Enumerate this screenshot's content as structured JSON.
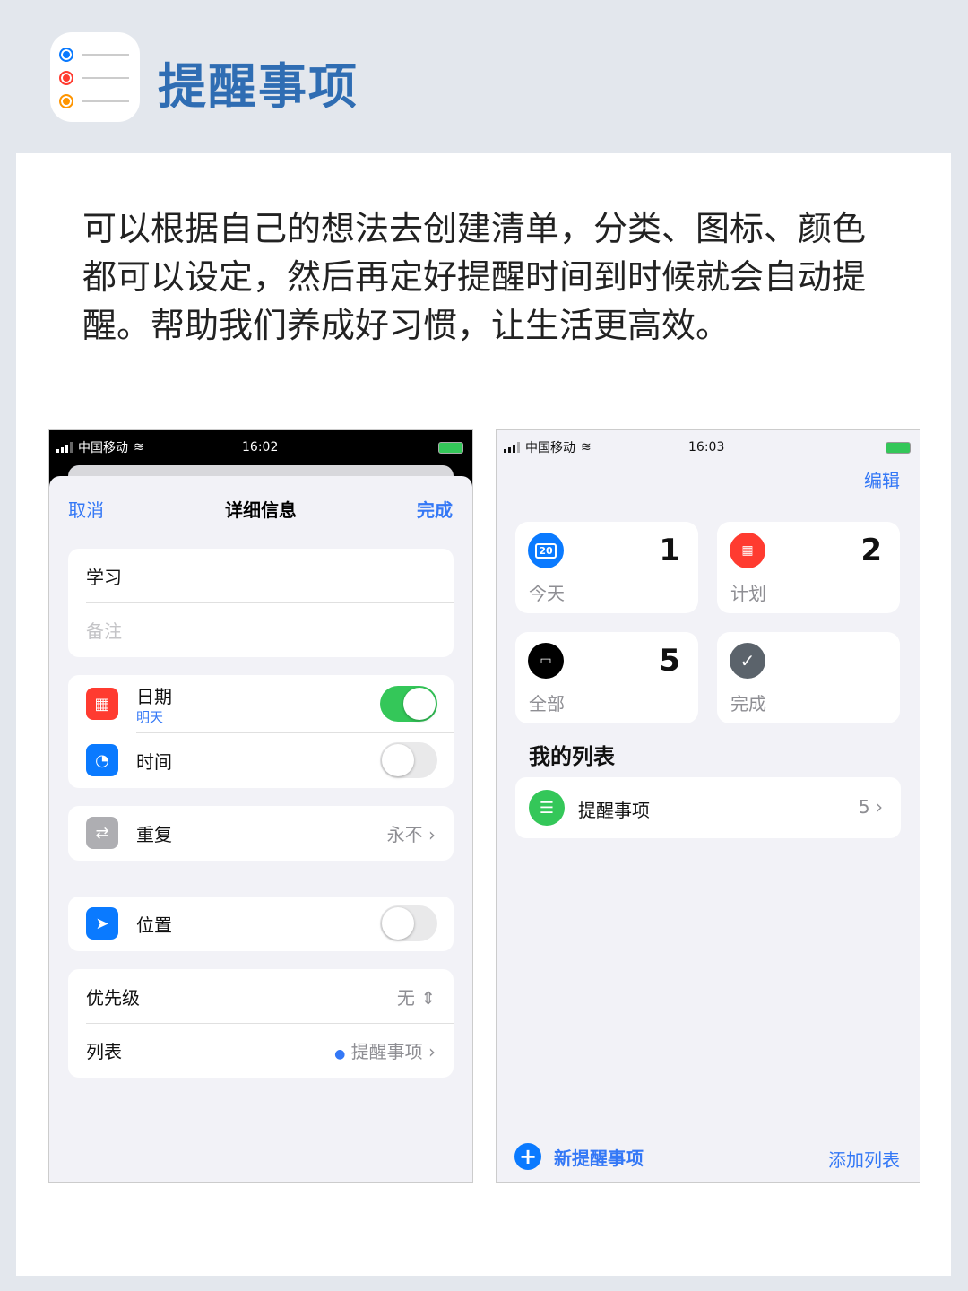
{
  "header": {
    "title": "提醒事项",
    "icon": "reminders-app-icon"
  },
  "description": "可以根据自己的想法去创建清单，分类、图标、颜色都可以设定，然后再定好提醒时间到时候就会自动提醒。帮助我们养成好习惯，让生活更高效。",
  "left_phone": {
    "status": {
      "carrier": "中国移动",
      "time": "16:02"
    },
    "nav": {
      "cancel": "取消",
      "title": "详细信息",
      "done": "完成"
    },
    "title_field": "学习",
    "notes_placeholder": "备注",
    "date": {
      "label": "日期",
      "sub": "明天",
      "on": true
    },
    "time": {
      "label": "时间",
      "on": false
    },
    "repeat": {
      "label": "重复",
      "value": "永不"
    },
    "location": {
      "label": "位置",
      "on": false
    },
    "priority": {
      "label": "优先级",
      "value": "无"
    },
    "list": {
      "label": "列表",
      "value": "提醒事项"
    }
  },
  "right_phone": {
    "status": {
      "carrier": "中国移动",
      "time": "16:03"
    },
    "edit": "编辑",
    "tiles": [
      {
        "label": "今天",
        "count": "1",
        "icon_text": "20",
        "color": "#0a7aff"
      },
      {
        "label": "计划",
        "count": "2",
        "color": "#ff3b30"
      },
      {
        "label": "全部",
        "count": "5",
        "color": "#000000"
      },
      {
        "label": "完成",
        "count": "",
        "color": "#5b636b"
      }
    ],
    "my_lists_title": "我的列表",
    "lists": [
      {
        "name": "提醒事项",
        "count": "5",
        "color": "#34c759"
      }
    ],
    "new_reminder": "新提醒事项",
    "add_list": "添加列表"
  }
}
